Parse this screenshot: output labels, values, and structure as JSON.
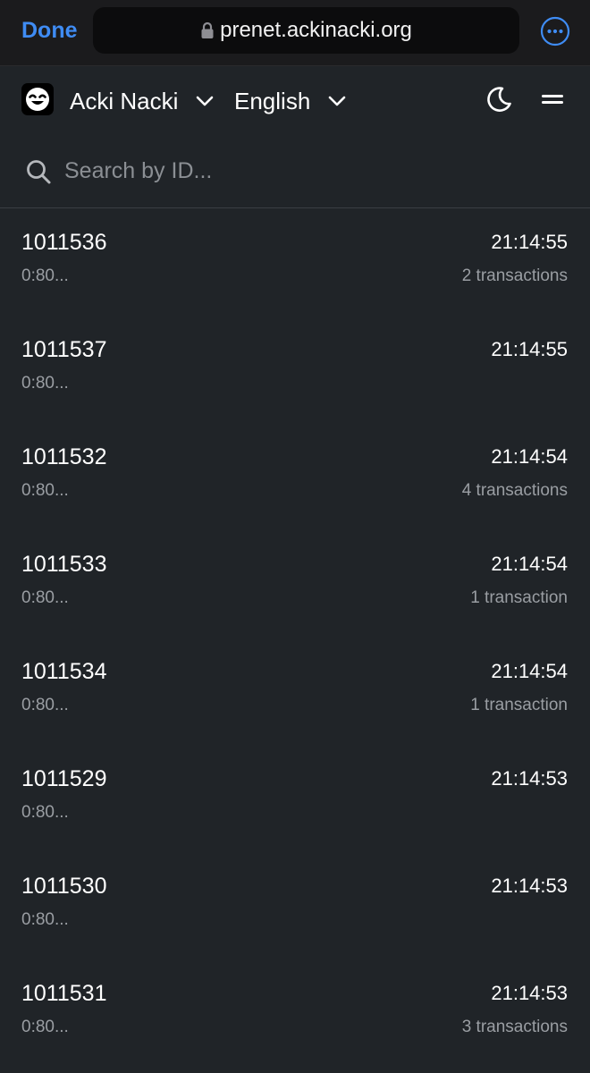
{
  "browser": {
    "done_label": "Done",
    "url": "prenet.ackinacki.org",
    "lock_icon": "lock-icon",
    "more_icon": "more-options-icon",
    "accent_color": "#3f8cf4"
  },
  "header": {
    "brand": "Acki Nacki",
    "language": "English",
    "logo_icon": "smiley-face-icon",
    "theme_icon": "moon-icon",
    "menu_icon": "hamburger-icon"
  },
  "search": {
    "placeholder": "Search by ID...",
    "value": ""
  },
  "blocks": [
    {
      "id": "1011536",
      "time": "21:14:55",
      "hash": "0:80...",
      "transactions": "2 transactions"
    },
    {
      "id": "1011537",
      "time": "21:14:55",
      "hash": "0:80...",
      "transactions": ""
    },
    {
      "id": "1011532",
      "time": "21:14:54",
      "hash": "0:80...",
      "transactions": "4 transactions"
    },
    {
      "id": "1011533",
      "time": "21:14:54",
      "hash": "0:80...",
      "transactions": "1 transaction"
    },
    {
      "id": "1011534",
      "time": "21:14:54",
      "hash": "0:80...",
      "transactions": "1 transaction"
    },
    {
      "id": "1011529",
      "time": "21:14:53",
      "hash": "0:80...",
      "transactions": ""
    },
    {
      "id": "1011530",
      "time": "21:14:53",
      "hash": "0:80...",
      "transactions": ""
    },
    {
      "id": "1011531",
      "time": "21:14:53",
      "hash": "0:80...",
      "transactions": "3 transactions"
    }
  ]
}
